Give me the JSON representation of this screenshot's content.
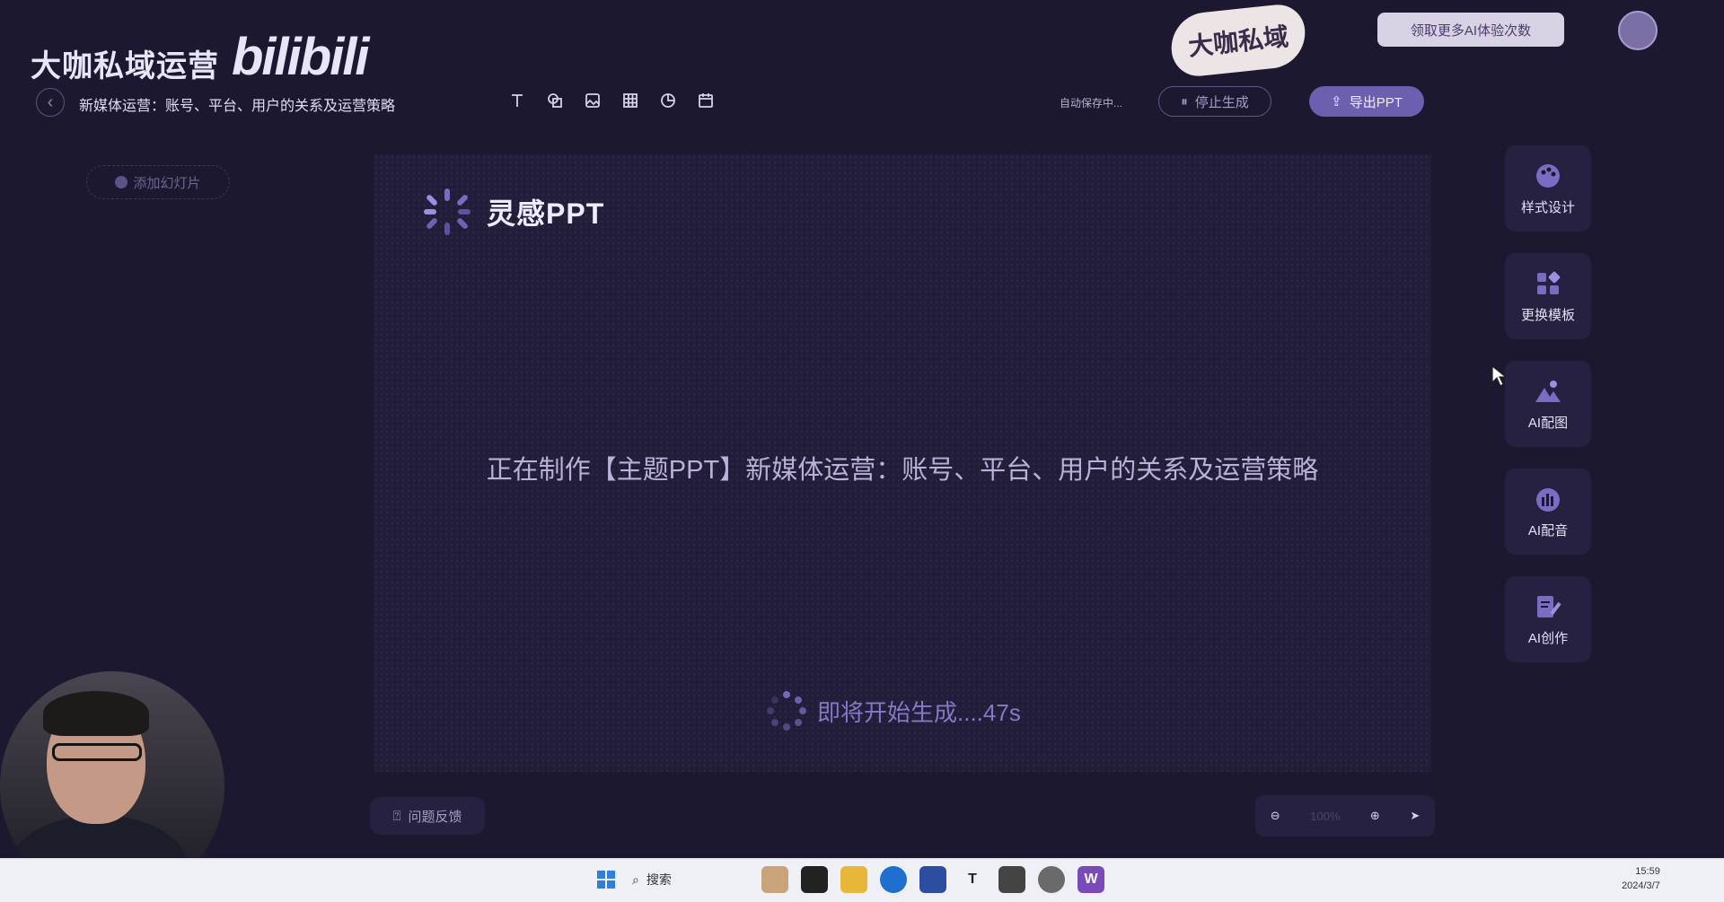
{
  "watermark": {
    "title": "大咖私域运营",
    "logo": "bilibili"
  },
  "sticker_text": "大咖私域",
  "promo_text": "领取更多AI体验次数",
  "header": {
    "doc_title": "新媒体运营：账号、平台、用户的关系及运营策略",
    "autosave": "自动保存中...",
    "stop_label": "停止生成",
    "export_label": "导出PPT"
  },
  "toolbar": [
    "text-icon",
    "shape-icon",
    "image-icon",
    "table-icon",
    "chart-icon",
    "calendar-icon"
  ],
  "left_panel": {
    "add_slide_label": "添加幻灯片"
  },
  "canvas": {
    "brand_name": "灵感PPT",
    "making_text": "正在制作【主题PPT】新媒体运营：账号、平台、用户的关系及运营策略",
    "loading_text": "即将开始生成....47s"
  },
  "side_tools": [
    {
      "label": "样式设计",
      "icon": "palette-icon"
    },
    {
      "label": "更换模板",
      "icon": "template-icon"
    },
    {
      "label": "AI配图",
      "icon": "picture-icon"
    },
    {
      "label": "AI配音",
      "icon": "voice-icon"
    },
    {
      "label": "AI创作",
      "icon": "write-icon"
    }
  ],
  "bottom": {
    "feedback_label": "问题反馈",
    "zoom_pct": "100%"
  },
  "taskbar": {
    "search_label": "搜索",
    "time": "15:59",
    "date": "2024/3/7"
  },
  "colors": {
    "accent": "#6c5fb0",
    "background": "#1c1830",
    "canvas": "#221d38"
  }
}
